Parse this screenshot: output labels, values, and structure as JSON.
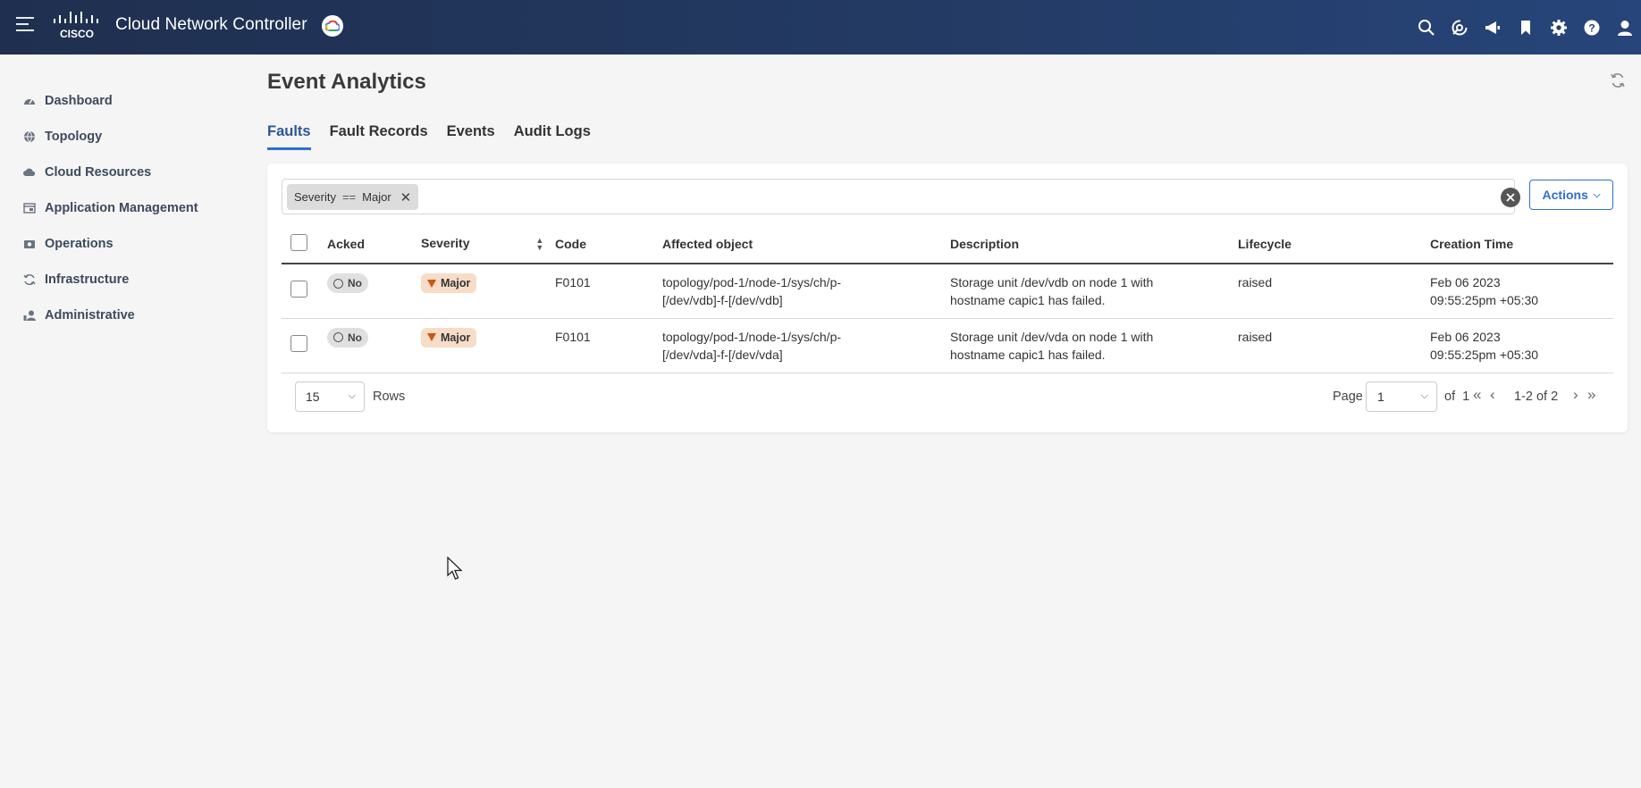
{
  "header": {
    "app_title": "Cloud Network Controller",
    "icons": [
      "search-icon",
      "activity-icon",
      "megaphone-icon",
      "bookmark-icon",
      "gear-icon",
      "help-icon",
      "user-icon"
    ]
  },
  "sidebar": {
    "items": [
      {
        "label": "Dashboard",
        "icon": "dashboard-icon"
      },
      {
        "label": "Topology",
        "icon": "topology-icon"
      },
      {
        "label": "Cloud Resources",
        "icon": "cloud-icon"
      },
      {
        "label": "Application Management",
        "icon": "app-icon"
      },
      {
        "label": "Operations",
        "icon": "operations-icon"
      },
      {
        "label": "Infrastructure",
        "icon": "infrastructure-icon"
      },
      {
        "label": "Administrative",
        "icon": "admin-icon"
      }
    ]
  },
  "main": {
    "title": "Event Analytics",
    "tabs": [
      {
        "label": "Faults",
        "active": true
      },
      {
        "label": "Fault Records",
        "active": false
      },
      {
        "label": "Events",
        "active": false
      },
      {
        "label": "Audit Logs",
        "active": false
      }
    ],
    "filter": {
      "field": "Severity",
      "operator": "==",
      "value": "Major"
    },
    "actions_label": "Actions",
    "table": {
      "columns": [
        "Acked",
        "Severity",
        "Code",
        "Affected object",
        "Description",
        "Lifecycle",
        "Creation Time"
      ],
      "rows": [
        {
          "acked": "No",
          "severity": "Major",
          "code": "F0101",
          "affected_line1": "topology/pod-1/node-1/sys/ch/p-",
          "affected_line2": "[/dev/vdb]-f-[/dev/vdb]",
          "desc_line1": "Storage unit /dev/vdb on node 1 with",
          "desc_line2": "hostname capic1 has failed.",
          "lifecycle": "raised",
          "time_line1": "Feb 06 2023",
          "time_line2": "09:55:25pm +05:30"
        },
        {
          "acked": "No",
          "severity": "Major",
          "code": "F0101",
          "affected_line1": "topology/pod-1/node-1/sys/ch/p-",
          "affected_line2": "[/dev/vda]-f-[/dev/vda]",
          "desc_line1": "Storage unit /dev/vda on node 1 with",
          "desc_line2": "hostname capic1 has failed.",
          "lifecycle": "raised",
          "time_line1": "Feb 06 2023",
          "time_line2": "09:55:25pm +05:30"
        }
      ]
    },
    "footer": {
      "rows_value": "15",
      "rows_label": "Rows",
      "page_label": "Page",
      "page_value": "1",
      "of_label": "of",
      "total_pages": "1",
      "range": "1-2 of 2"
    }
  },
  "colors": {
    "header_bg": "#233a63",
    "accent": "#2f6fcf",
    "major_badge": "#f7dcc7",
    "major_icon": "#c55a11"
  }
}
